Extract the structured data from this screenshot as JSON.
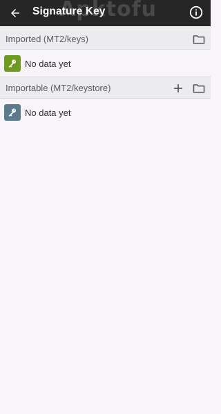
{
  "appbar": {
    "title": "Signature Key",
    "watermark": "Apktofu",
    "back_icon": "arrow-back-icon",
    "info_icon": "info-icon"
  },
  "sections": [
    {
      "header": "Imported (MT2/keys)",
      "actions": [
        "folder-icon"
      ],
      "item_text": "No data yet",
      "key_color": "#6e9a1e"
    },
    {
      "header": "Importable (MT2/keystore)",
      "actions": [
        "plus-icon",
        "folder-icon"
      ],
      "item_text": "No data yet",
      "key_color": "#5b7a8e"
    }
  ],
  "colors": {
    "appbar_bg": "#262626",
    "page_bg": "#f8f5fa",
    "section_bg": "#ececee"
  }
}
